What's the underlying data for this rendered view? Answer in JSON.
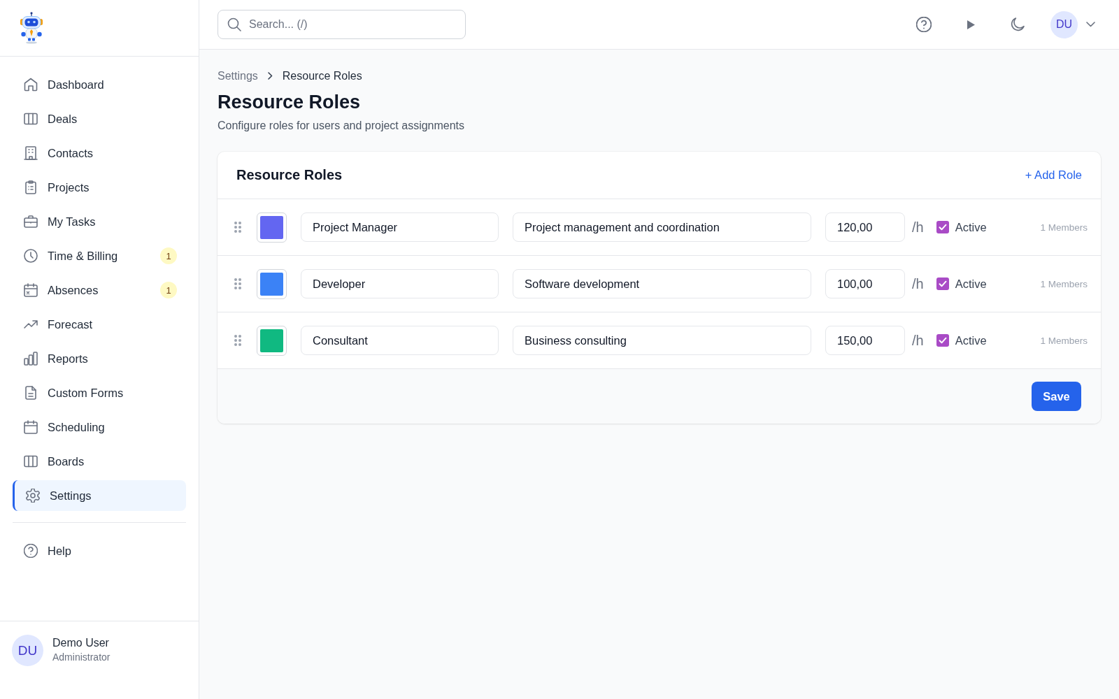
{
  "sidebar": {
    "items": [
      {
        "label": "Dashboard",
        "selected": false
      },
      {
        "label": "Deals",
        "selected": false
      },
      {
        "label": "Contacts",
        "selected": false
      },
      {
        "label": "Projects",
        "selected": false
      },
      {
        "label": "My Tasks",
        "selected": false
      },
      {
        "label": "Time & Billing",
        "badge": "1",
        "selected": false
      },
      {
        "label": "Absences",
        "badge": "1",
        "selected": false
      },
      {
        "label": "Forecast",
        "selected": false
      },
      {
        "label": "Reports",
        "selected": false
      },
      {
        "label": "Custom Forms",
        "selected": false
      },
      {
        "label": "Scheduling",
        "selected": false
      },
      {
        "label": "Boards",
        "selected": false
      },
      {
        "label": "Settings",
        "selected": true
      }
    ],
    "bottom_items": [
      {
        "label": "Help",
        "selected": false
      }
    ],
    "user": {
      "initials": "DU",
      "name": "Demo User",
      "role": "Administrator"
    }
  },
  "topbar": {
    "search": {
      "placeholder": "Search... (/)"
    },
    "user_initials": "DU"
  },
  "breadcrumb": [
    {
      "label": "Settings"
    },
    {
      "label": "Resource Roles"
    }
  ],
  "page": {
    "title": "Resource Roles",
    "subtitle": "Configure roles for users and project assignments"
  },
  "roles_card": {
    "title": "Resource Roles",
    "add_button": "+ Add Role",
    "roles": [
      {
        "color": "#6366f1",
        "name": "Project Manager",
        "description": "Project management and coordination",
        "rate": "120,00",
        "unit": "/h",
        "checked": true,
        "status_label": "Active",
        "members": "1 Members"
      },
      {
        "color": "#3b82f6",
        "name": "Developer",
        "description": "Software development",
        "rate": "100,00",
        "unit": "/h",
        "checked": true,
        "status_label": "Active",
        "members": "1 Members"
      },
      {
        "color": "#10b981",
        "name": "Consultant",
        "description": "Business consulting",
        "rate": "150,00",
        "unit": "/h",
        "checked": true,
        "status_label": "Active",
        "members": "1 Members"
      }
    ],
    "save_button": "Save"
  }
}
